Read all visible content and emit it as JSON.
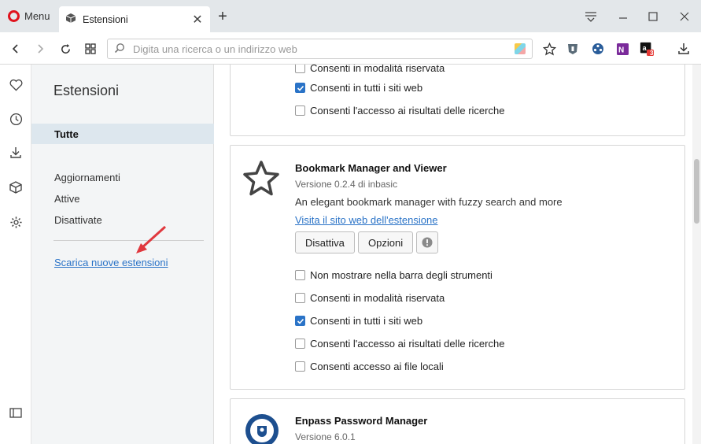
{
  "browser": {
    "menu_label": "Menu",
    "tab_title": "Estensioni",
    "search_placeholder": "Digita una ricerca o un indirizzo web",
    "badge_count": "3"
  },
  "sidebar": {
    "title": "Estensioni",
    "items": [
      {
        "label": "Tutte",
        "active": true
      },
      {
        "label": "Aggiornamenti",
        "active": false
      },
      {
        "label": "Attive",
        "active": false
      },
      {
        "label": "Disattivate",
        "active": false
      }
    ],
    "get_more_link": "Scarica nuove estensioni"
  },
  "extensions": [
    {
      "partial": true,
      "options": [
        {
          "label": "Consenti in modalità riservata",
          "checked": false
        },
        {
          "label": "Consenti in tutti i siti web",
          "checked": true
        },
        {
          "label": "Consenti l'accesso ai risultati delle ricerche",
          "checked": false
        }
      ]
    },
    {
      "name": "Bookmark Manager and Viewer",
      "version": "Versione 0.2.4 di inbasic",
      "description": "An elegant bookmark manager with fuzzy search and more",
      "website_link": "Visita il sito web dell'estensione",
      "disable_label": "Disattiva",
      "options_label": "Opzioni",
      "options": [
        {
          "label": "Non mostrare nella barra degli strumenti",
          "checked": false
        },
        {
          "label": "Consenti in modalità riservata",
          "checked": false
        },
        {
          "label": "Consenti in tutti i siti web",
          "checked": true
        },
        {
          "label": "Consenti l'accesso ai risultati delle ricerche",
          "checked": false
        },
        {
          "label": "Consenti accesso ai file locali",
          "checked": false
        }
      ]
    },
    {
      "name": "Enpass Password Manager",
      "version": "Versione 6.0.1"
    }
  ],
  "colors": {
    "accent": "#2a73c7",
    "opera_red": "#e0131d",
    "arrow_red": "#e0383e"
  }
}
